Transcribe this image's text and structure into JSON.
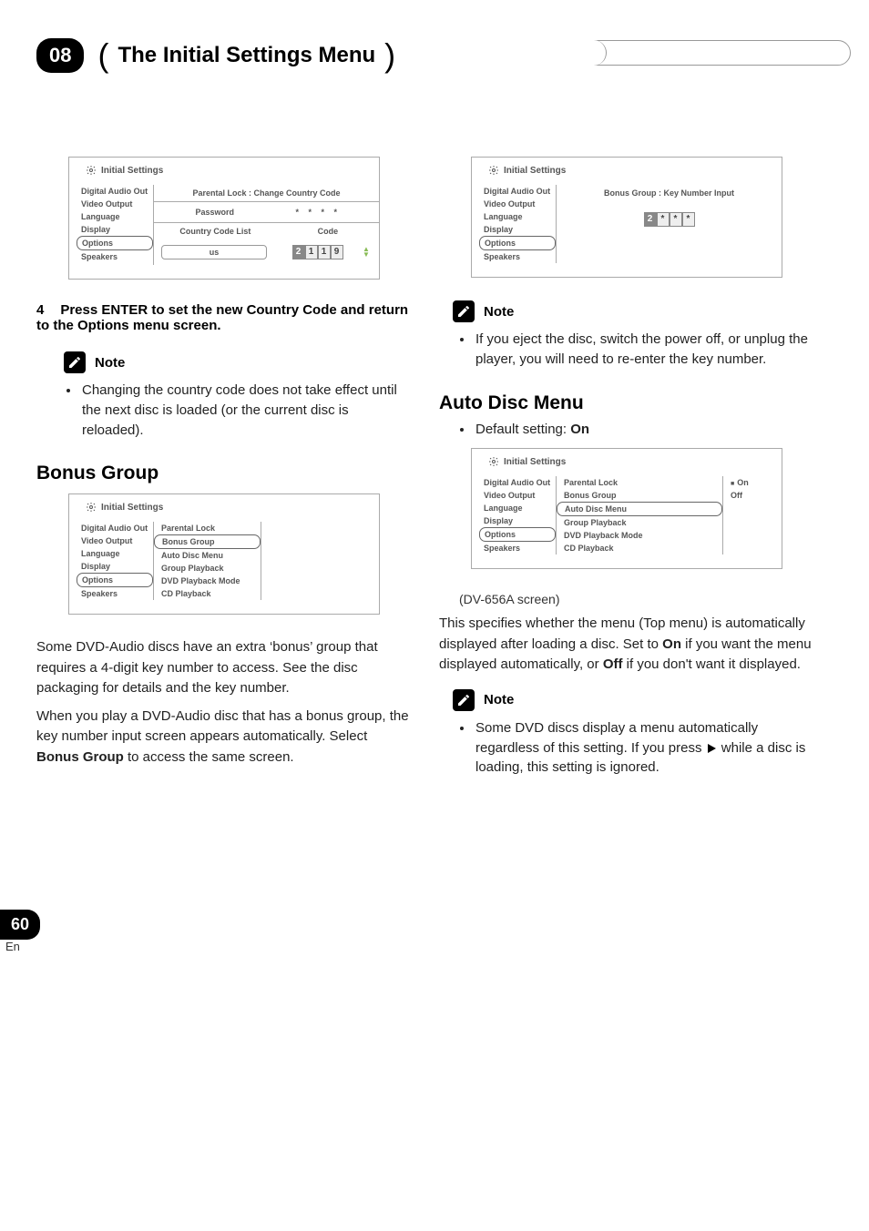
{
  "chapter": {
    "number": "08",
    "title": "The Initial Settings Menu"
  },
  "page": {
    "number": "60",
    "lang": "En"
  },
  "common": {
    "settings_header": "Initial Settings",
    "nav_items": [
      "Digital Audio Out",
      "Video Output",
      "Language",
      "Display",
      "Options",
      "Speakers"
    ],
    "options_submenu": [
      "Parental Lock",
      "Bonus Group",
      "Auto Disc Menu",
      "Group Playback",
      "DVD Playback Mode",
      "CD Playback"
    ]
  },
  "screens": {
    "country_code": {
      "pane_title": "Parental Lock : Change Country Code",
      "password_label": "Password",
      "password_mask": "* * * *",
      "list_header_a": "Country Code List",
      "list_header_b": "Code",
      "country_value": "us",
      "code_digits": [
        "2",
        "1",
        "1",
        "9"
      ]
    },
    "bonus_input": {
      "pane_title": "Bonus Group : Key Number Input",
      "digits": [
        "2",
        "*",
        "*",
        "*"
      ]
    },
    "auto_disc": {
      "option_on": "On",
      "option_off": "Off"
    }
  },
  "left_col": {
    "step4": {
      "num": "4",
      "text_a": "Press ENTER to set the new Country Code and return to the Options menu screen."
    },
    "note_label": "Note",
    "note_bullet": "Changing the country code does not take effect until the next disc is loaded (or the current disc is reloaded).",
    "bonus_heading": "Bonus Group",
    "bonus_para1": "Some DVD-Audio discs have an extra ‘bonus’ group that requires a 4-digit key number to access. See the disc packaging for details and the key number.",
    "bonus_para2_a": "When you play a DVD-Audio disc that has a bonus group, the key number input screen appears automatically. Select ",
    "bonus_para2_bold": "Bonus Group",
    "bonus_para2_b": " to access the same screen."
  },
  "right_col": {
    "note_label": "Note",
    "eject_bullet": "If you eject the disc, switch the power off, or unplug the player, you will need to re-enter the key number.",
    "auto_heading": "Auto Disc Menu",
    "default_prefix": "Default setting: ",
    "default_bold": "On",
    "caption": "(DV-656A screen)",
    "auto_para_a": "This specifies whether the menu (Top menu) is automatically displayed after loading a disc. Set to ",
    "auto_para_on": "On",
    "auto_para_b": " if you want the menu displayed automatically, or ",
    "auto_para_off": "Off",
    "auto_para_c": " if you don't want it displayed.",
    "note2_bullet_a": "Some DVD discs display a menu automatically regardless of this setting. If you press ",
    "note2_bullet_b": " while a disc is loading, this setting is ignored."
  }
}
